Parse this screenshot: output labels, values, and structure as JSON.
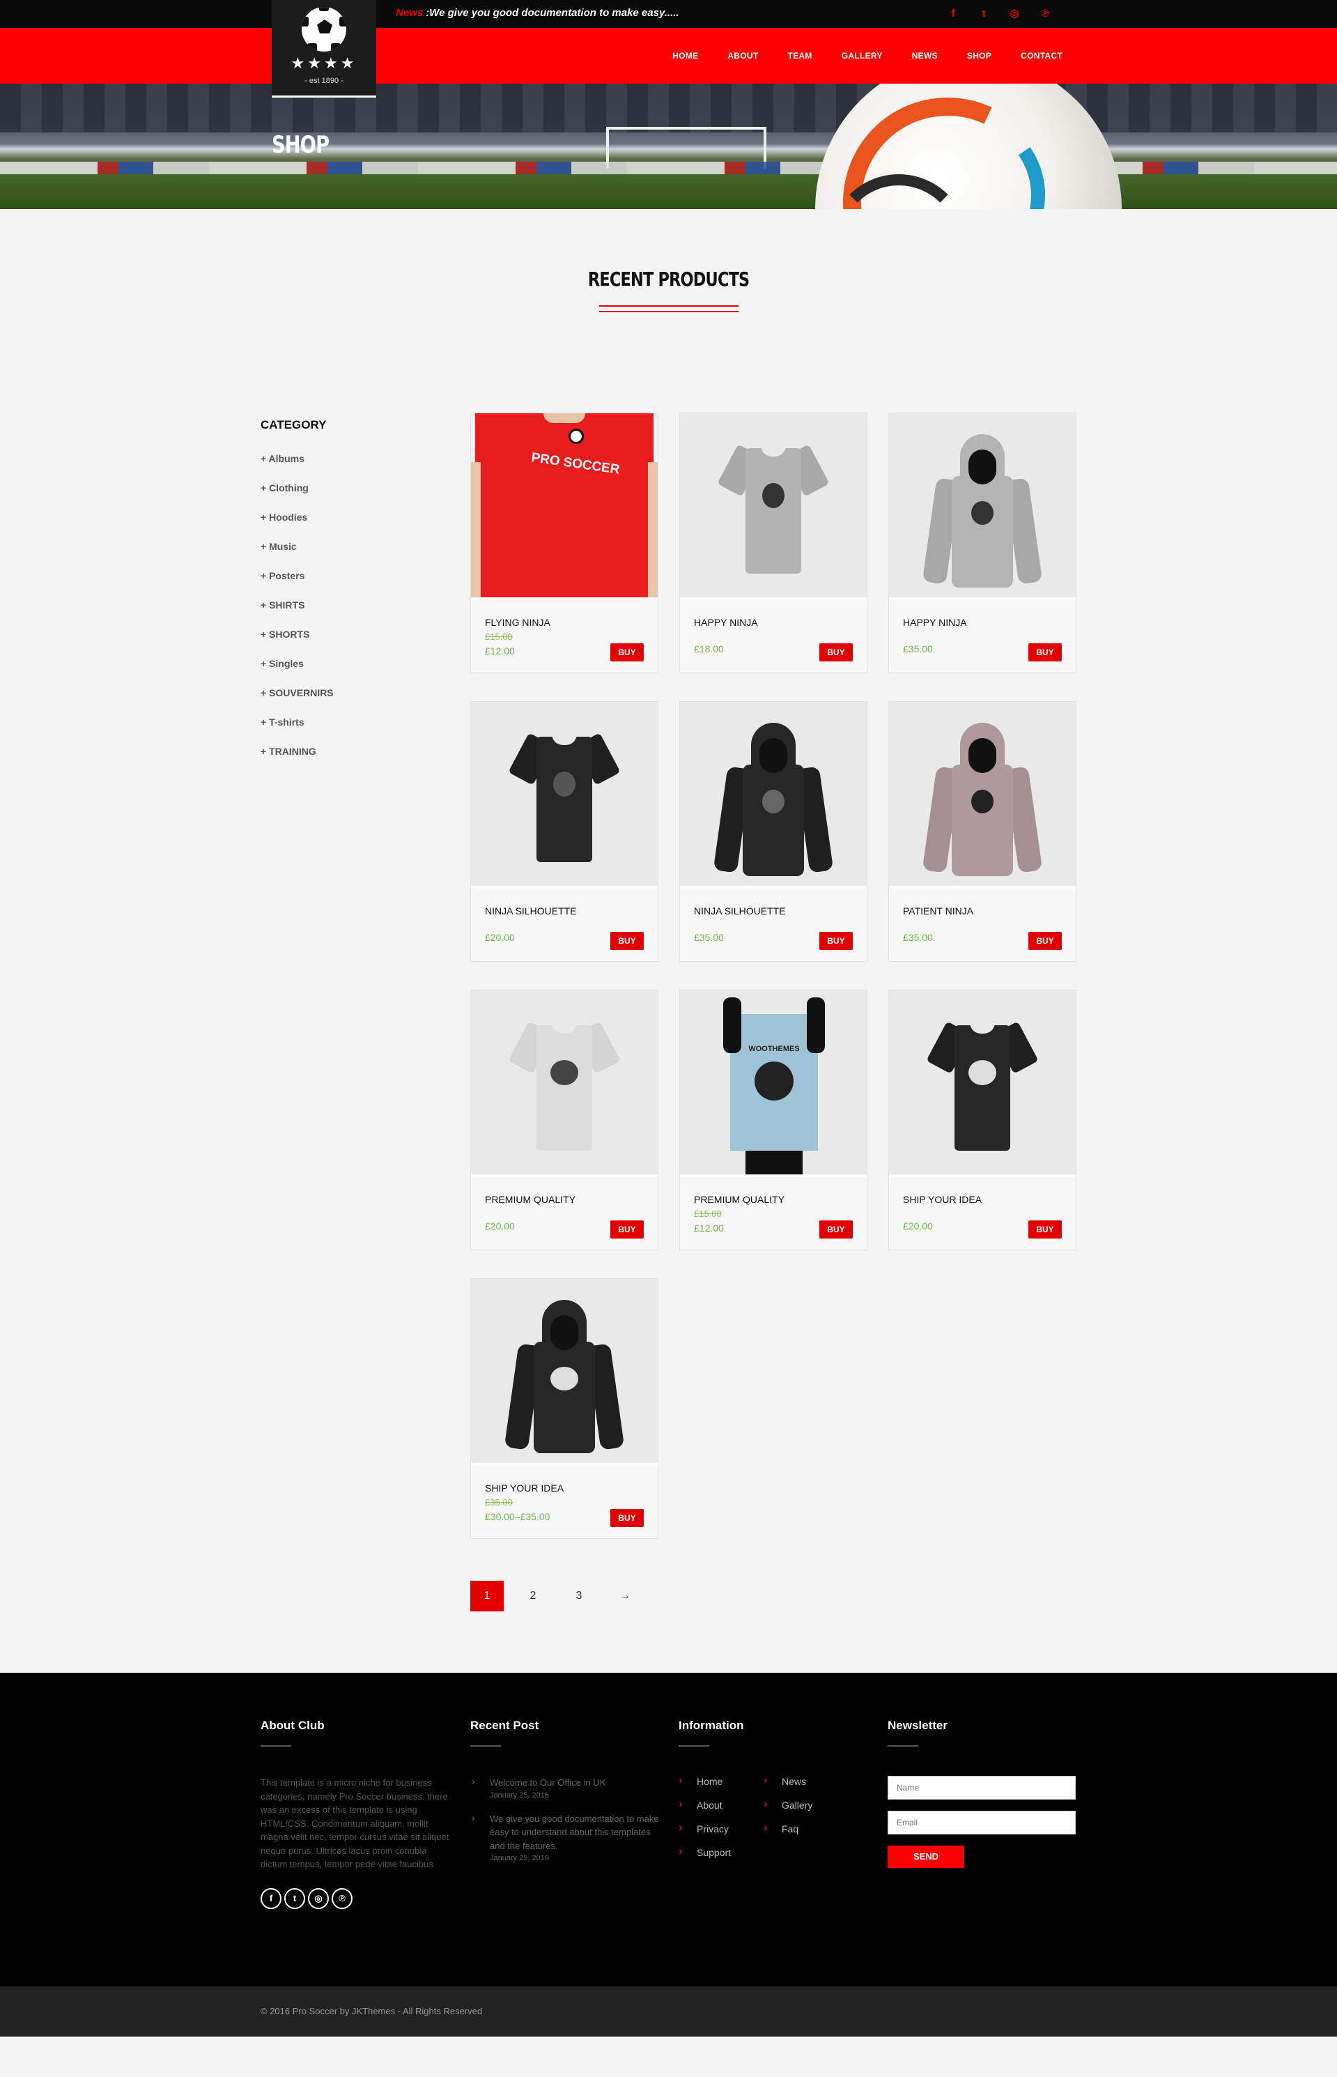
{
  "topbar": {
    "news_tag": "News",
    "news_text": ":We give you good documentation to make easy.....",
    "social_icons": [
      "facebook-icon",
      "twitter-icon",
      "instagram-icon",
      "pinterest-icon"
    ],
    "social_glyphs": [
      "f",
      "t",
      "◎",
      "℗"
    ]
  },
  "logo": {
    "stars": "★★★★",
    "est": "- est 1890 -"
  },
  "nav": [
    "HOME",
    "ABOUT",
    "TEAM",
    "GALLERY",
    "NEWS",
    "SHOP",
    "CONTACT"
  ],
  "hero": {
    "title": "SHOP"
  },
  "section": {
    "title": "RECENT PRODUCTS"
  },
  "sidebar": {
    "title": "CATEGORY",
    "items": [
      "+ Albums",
      "+ Clothing",
      "+ Hoodies",
      "+ Music",
      "+ Posters",
      "+ SHIRTS",
      "+ SHORTS",
      "+ Singles",
      "+ SOUVERNIRS",
      "+ T-shirts",
      "+ TRAINING"
    ]
  },
  "products": [
    {
      "name": "FLYING NINJA",
      "old_price": "£15.00",
      "price": "£12.00",
      "buy": "BUY"
    },
    {
      "name": "HAPPY NINJA",
      "old_price": "",
      "price": "£18.00",
      "buy": "BUY"
    },
    {
      "name": "HAPPY NINJA",
      "old_price": "",
      "price": "£35.00",
      "buy": "BUY"
    },
    {
      "name": "NINJA SILHOUETTE",
      "old_price": "",
      "price": "£20.00",
      "buy": "BUY"
    },
    {
      "name": "NINJA SILHOUETTE",
      "old_price": "",
      "price": "£35.00",
      "buy": "BUY"
    },
    {
      "name": "PATIENT NINJA",
      "old_price": "",
      "price": "£35.00",
      "buy": "BUY"
    },
    {
      "name": "PREMIUM QUALITY",
      "old_price": "",
      "price": "£20.00",
      "buy": "BUY"
    },
    {
      "name": "PREMIUM QUALITY",
      "old_price": "£15.00",
      "price": "£12.00",
      "buy": "BUY"
    },
    {
      "name": "SHIP YOUR IDEA",
      "old_price": "",
      "price": "£20.00",
      "buy": "BUY"
    },
    {
      "name": "SHIP YOUR IDEA",
      "old_price": "£35.00",
      "price": "£30.00–£35.00",
      "buy": "BUY"
    }
  ],
  "product_art": {
    "redtee_text": "PRO SOCCER",
    "poster_text": "WOOTHEMES"
  },
  "pagination": [
    "1",
    "2",
    "3",
    "→"
  ],
  "footer": {
    "about": {
      "title": "About Club",
      "text": "This template is a micro niche for business categories, namely Pro Soccer business. there was an excess of this template is using HTML/CSS. Condimentum aliquam, mollit magna velit nec, tempor cursus vitae sit aliquet neque purus. Ultrices lacus proin conubia dictum tempus, tempor pede vitae faucibus",
      "socials": [
        "f",
        "t",
        "◎",
        "℗"
      ]
    },
    "recent": {
      "title": "Recent Post",
      "posts": [
        {
          "title": "Welcome to Our Office in UK",
          "date": "January 25, 2016"
        },
        {
          "title": "We give you good documentation to make easy to understand about this templates and the features.",
          "date": "January 25, 2016"
        }
      ]
    },
    "info": {
      "title": "Information",
      "links": [
        "Home",
        "News",
        "About",
        "Gallery",
        "Privacy",
        "Faq",
        "Support"
      ]
    },
    "newsletter": {
      "title": "Newsletter",
      "name_placeholder": "Name",
      "email_placeholder": "Email",
      "send": "SEND"
    }
  },
  "copyright": "© 2016 Pro Soccer by JKThemes - All Rights Reserved",
  "colors": {
    "accent": "#ff0000",
    "price": "#6fb84a",
    "footer": "#000000"
  }
}
